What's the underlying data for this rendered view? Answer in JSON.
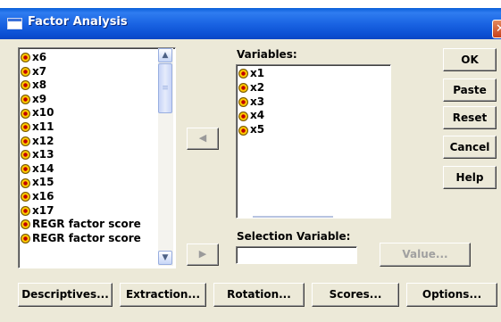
{
  "window": {
    "title": "Factor Analysis",
    "close_symbol": "✕"
  },
  "source_list": {
    "items": [
      "x6",
      "x7",
      "x8",
      "x9",
      "x10",
      "x11",
      "x12",
      "x13",
      "x14",
      "x15",
      "x16",
      "x17",
      "REGR factor score",
      "REGR factor score"
    ],
    "scroll_up_glyph": "▲",
    "scroll_down_glyph": "▼",
    "thumb_grip": "≡"
  },
  "variables": {
    "label": "Variables:",
    "items": [
      "x1",
      "x2",
      "x3",
      "x4",
      "x5"
    ]
  },
  "transfer": {
    "to_variables_glyph": "◀",
    "to_selection_glyph": "▶"
  },
  "selection_variable": {
    "label": "Selection Variable:",
    "value": ""
  },
  "buttons": {
    "ok": "OK",
    "paste": "Paste",
    "reset": "Reset",
    "cancel": "Cancel",
    "help": "Help",
    "value": "Value...",
    "descriptives": "Descriptives...",
    "extraction": "Extraction...",
    "rotation": "Rotation...",
    "scores": "Scores...",
    "options": "Options..."
  },
  "colors": {
    "titlebar": "#0a5fd8",
    "dialog_bg": "#ece9d8",
    "disabled_text": "#a0a0a0"
  }
}
